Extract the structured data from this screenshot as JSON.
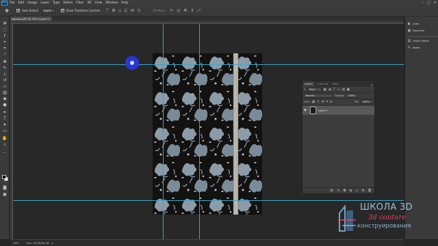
{
  "app": {
    "logo": "Ps",
    "menu": [
      "File",
      "Edit",
      "Image",
      "Layer",
      "Type",
      "Select",
      "Filter",
      "3D",
      "View",
      "Window",
      "Help"
    ],
    "window_controls": [
      "–",
      "□",
      "✕"
    ]
  },
  "options_bar": {
    "tool_icon": "move-tool-icon",
    "auto_select_label": "Auto-Select:",
    "auto_select_value": "Layer",
    "show_transform_label": "Show Transform Controls",
    "mode_label": "3D Mode:"
  },
  "document": {
    "tab_title": "sapvaza.JPG @ 25% (Layer 0, RGB/8)"
  },
  "dock": {
    "items": [
      {
        "icon": "color-icon",
        "label": "Color"
      },
      {
        "icon": "swatches-icon",
        "label": "Swatches"
      },
      {
        "icon": "layer-comps-icon",
        "label": "Layer Comps"
      },
      {
        "icon": "notes-icon",
        "label": "Notes"
      }
    ]
  },
  "layers_panel": {
    "tabs": [
      "Layers",
      "Channels",
      "Paths"
    ],
    "active_tab": "Layers",
    "filter_value": "Kind",
    "blend_mode": "Normal",
    "opacity_label": "Opacity:",
    "opacity_value": "100%",
    "lock_label": "Lock:",
    "fill_label": "Fill:",
    "fill_value": "100%",
    "layers": [
      {
        "name": "Layer 0",
        "visible": true
      }
    ]
  },
  "status_bar": {
    "zoom": "25%",
    "doc_info": "Doc: 34,3M/34,3M"
  },
  "watermark": {
    "line1": "ШКОЛА 3D",
    "line2": "3d couture",
    "line3": "конструирования",
    "colors": {
      "primary": "#9dbfd8",
      "accent": "#e2435c"
    }
  },
  "colors": {
    "guide": "#3aa6c8",
    "cursor": "#2738d8",
    "fabric_flowers": "#a9bccc",
    "fabric_ground": "#141311"
  }
}
